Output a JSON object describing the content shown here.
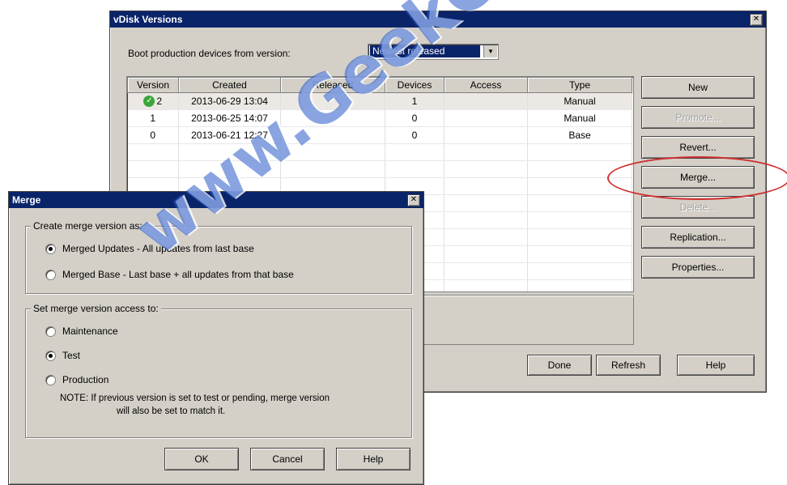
{
  "vdisk_dialog": {
    "title": "vDisk Versions",
    "boot_label": "Boot production devices from version:",
    "boot_select_value": "Newest released",
    "columns": [
      "Version",
      "Created",
      "Released",
      "Devices",
      "Access",
      "Type"
    ],
    "rows": [
      {
        "version": "2",
        "created": "2013-06-29 13:04",
        "released": "",
        "devices": "1",
        "access": "",
        "type": "Manual",
        "icon": "check-icon"
      },
      {
        "version": "1",
        "created": "2013-06-25 14:07",
        "released": "",
        "devices": "0",
        "access": "",
        "type": "Manual"
      },
      {
        "version": "0",
        "created": "2013-06-21 12:27",
        "released": "",
        "devices": "0",
        "access": "",
        "type": "Base"
      }
    ],
    "side_buttons": {
      "new": "New",
      "promote": "Promote...",
      "revert": "Revert...",
      "merge": "Merge...",
      "delete": "Delete...",
      "replication": "Replication...",
      "properties": "Properties..."
    },
    "bottom_buttons": {
      "done": "Done",
      "refresh": "Refresh",
      "help": "Help"
    }
  },
  "merge_dialog": {
    "title": "Merge",
    "group1_label": "Create merge version as:",
    "opt_updates": "Merged Updates - All updates from last base",
    "opt_base": "Merged Base - Last base + all updates from that base",
    "group2_label": "Set merge version access to:",
    "opt_maintenance": "Maintenance",
    "opt_test": "Test",
    "opt_production": "Production",
    "note_line1": "NOTE:  If previous version is set to test or pending, merge version",
    "note_line2": "will also be set to match it.",
    "ok": "OK",
    "cancel": "Cancel",
    "help": "Help"
  },
  "watermark": "www.GeekCert.com",
  "colors": {
    "titlebar": "#0a246a",
    "dialog_bg": "#d4d0c8",
    "highlight": "#d03030"
  }
}
